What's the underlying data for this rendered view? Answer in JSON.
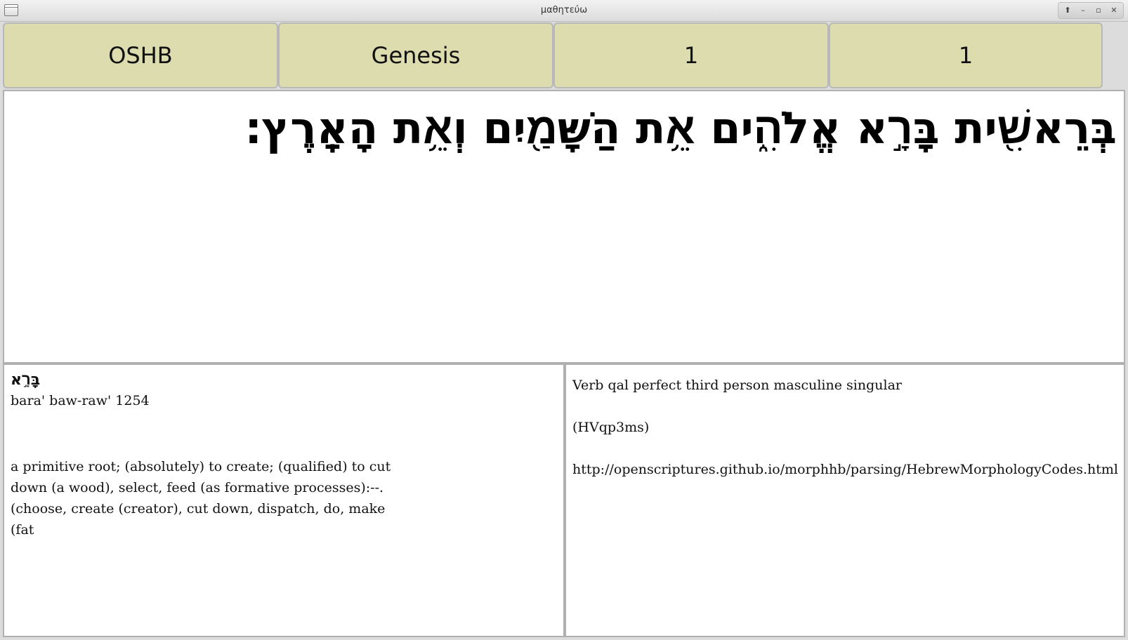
{
  "window": {
    "title": "μαθητεύω",
    "controls": {
      "shade": "⬆",
      "minimize": "–",
      "maximize": "▫",
      "close": "✕"
    }
  },
  "nav": {
    "version": "OSHB",
    "book": "Genesis",
    "chapter": "1",
    "verse": "1"
  },
  "verse_words": [
    "בְּרֵאשִׁ֖ית",
    "בָּרָ֣א",
    "אֱלֹהִ֑ים",
    "אֵ֥ת",
    "הַשָּׁמַ֖יִם",
    "וְאֵ֥ת",
    "הָאָֽרֶץ׃"
  ],
  "lexicon": {
    "word": "בָּרָ֣א",
    "transliteration": "bara' baw-raw' 1254",
    "definition": "a primitive root; (absolutely) to create; (qualified) to cut down (a wood), select, feed (as formative processes):--.(choose, create (creator), cut down, dispatch, do, make (fat"
  },
  "morphology": {
    "description": "Verb qal perfect third person masculine singular",
    "code": "(HVqp3ms)",
    "link": "http://openscriptures.github.io/morphhb/parsing/HebrewMorphologyCodes.html"
  }
}
